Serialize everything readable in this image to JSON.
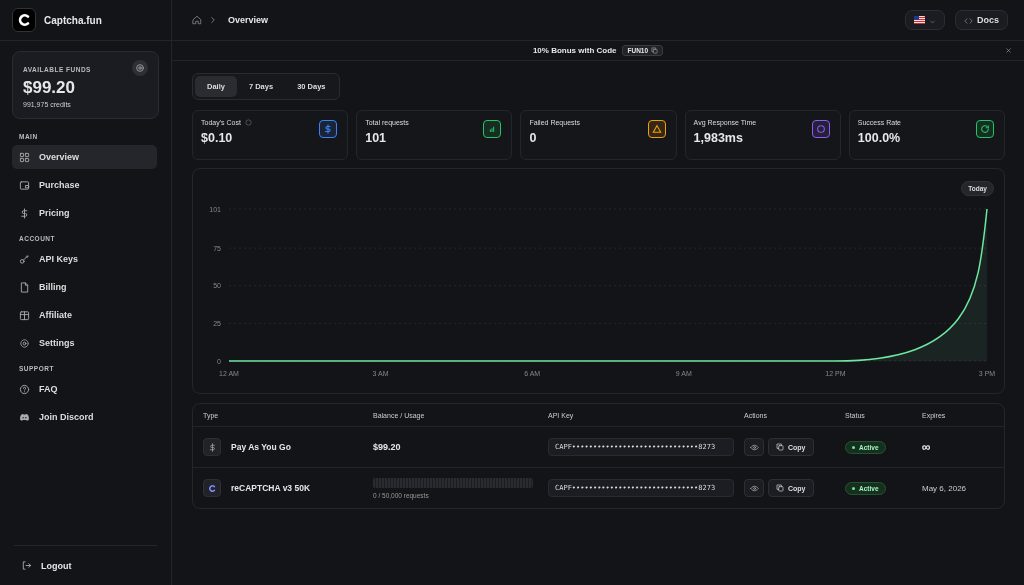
{
  "sidebar": {
    "brand": "Captcha.fun",
    "funds": {
      "label": "AVAILABLE FUNDS",
      "amount": "$99.20",
      "credits": "991,975 credits"
    },
    "sections": [
      {
        "title": "MAIN",
        "items": [
          {
            "label": "Overview",
            "selected": true
          },
          {
            "label": "Purchase",
            "selected": false
          },
          {
            "label": "Pricing",
            "selected": false
          }
        ]
      },
      {
        "title": "ACCOUNT",
        "items": [
          {
            "label": "API Keys",
            "selected": false
          },
          {
            "label": "Billing",
            "selected": false
          },
          {
            "label": "Affiliate",
            "selected": false
          },
          {
            "label": "Settings",
            "selected": false
          }
        ]
      },
      {
        "title": "SUPPORT",
        "items": [
          {
            "label": "FAQ",
            "selected": false
          },
          {
            "label": "Join Discord",
            "selected": false
          }
        ]
      }
    ],
    "logout": "Logout"
  },
  "header": {
    "breadcrumb": "Overview",
    "docs": "Docs"
  },
  "banner": {
    "text": "10% Bonus with Code",
    "code": "FUN10"
  },
  "periods": [
    {
      "label": "Daily",
      "selected": true
    },
    {
      "label": "7 Days",
      "selected": false
    },
    {
      "label": "30 Days",
      "selected": false
    }
  ],
  "stats": [
    {
      "label": "Today's Cost",
      "value": "$0.10",
      "color": "#3b82f6",
      "info": true
    },
    {
      "label": "Total requests",
      "value": "101",
      "color": "#22c55e",
      "info": false
    },
    {
      "label": "Failed Requests",
      "value": "0",
      "color": "#f59e0b",
      "info": false
    },
    {
      "label": "Avg Response Time",
      "value": "1,983ms",
      "color": "#8b5cf6",
      "info": false
    },
    {
      "label": "Success Rate",
      "value": "100.0%",
      "color": "#22c55e",
      "info": false
    }
  ],
  "chart": {
    "badge": "Today",
    "chart_data": {
      "type": "area",
      "grid": true,
      "categories": [
        "12 AM",
        "3 AM",
        "6 AM",
        "9 AM",
        "12 PM",
        "3 PM"
      ],
      "series": [
        {
          "color": "#6ee7a0",
          "values": [
            0,
            0,
            0,
            0,
            0,
            101
          ]
        }
      ],
      "ylim": [
        0,
        101
      ],
      "yticks": [
        0,
        25,
        50,
        75,
        101
      ]
    }
  },
  "table": {
    "columns": [
      "Type",
      "Balance / Usage",
      "API Key",
      "Actions",
      "Status",
      "Expires"
    ],
    "rows": [
      {
        "kind": "balance",
        "type": "Pay As You Go",
        "balance": "$99.20",
        "api_key": "CAPF••••••••••••••••••••••••••••••8273",
        "copy": "Copy",
        "status": "Active",
        "expires": "∞"
      },
      {
        "kind": "usage",
        "type": "reCAPTCHA v3 50K",
        "level": 0,
        "usage": "0 / 50,000 requests",
        "api_key": "CAPF••••••••••••••••••••••••••••••8273",
        "copy": "Copy",
        "status": "Active",
        "expires": "May 6, 2026"
      }
    ]
  }
}
